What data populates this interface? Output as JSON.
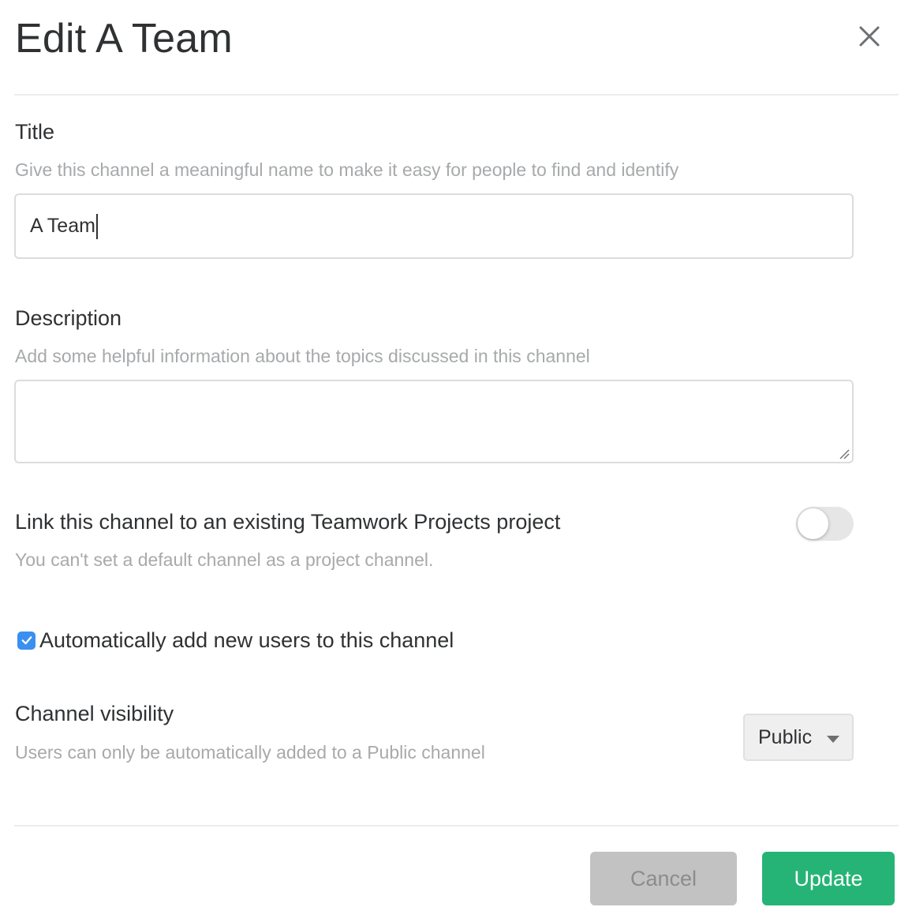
{
  "dialog": {
    "title": "Edit A Team",
    "close_icon": "close-icon"
  },
  "title_field": {
    "label": "Title",
    "help": "Give this channel a meaningful name to make it easy for people to find and identify",
    "value": "A Team"
  },
  "description_field": {
    "label": "Description",
    "help": "Add some helpful information about the topics discussed in this channel",
    "value": ""
  },
  "project_link": {
    "label": "Link this channel to an existing Teamwork Projects project",
    "help": "You can't set a default channel as a project channel.",
    "enabled": false
  },
  "auto_add": {
    "label": "Automatically add new users to this channel",
    "checked": true
  },
  "visibility": {
    "label": "Channel visibility",
    "help": "Users can only be automatically added to a Public channel",
    "selected": "Public"
  },
  "footer": {
    "cancel_label": "Cancel",
    "update_label": "Update"
  },
  "colors": {
    "primary_green": "#26b476",
    "checkbox_blue": "#3b8ff0",
    "muted_text": "#a7a9ab"
  }
}
